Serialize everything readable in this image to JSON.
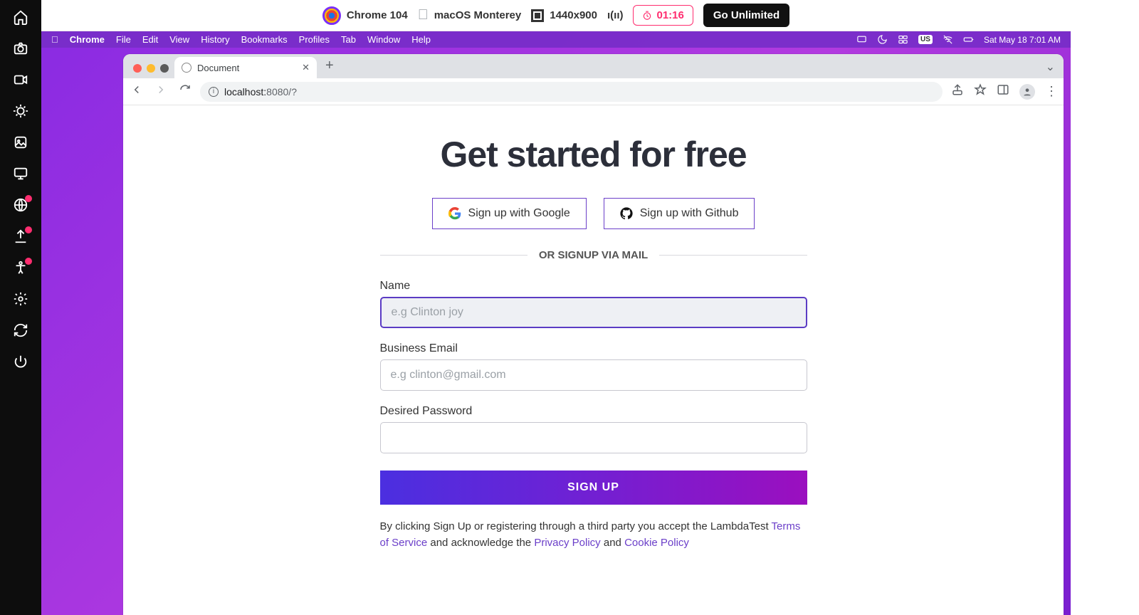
{
  "lt_topbar": {
    "browser": "Chrome 104",
    "os": "macOS Monterey",
    "resolution": "1440x900",
    "timer": "01:16",
    "cta": "Go Unlimited"
  },
  "mac_menu": {
    "app": "Chrome",
    "items": [
      "File",
      "Edit",
      "View",
      "History",
      "Bookmarks",
      "Profiles",
      "Tab",
      "Window",
      "Help"
    ],
    "locale": "US",
    "datetime": "Sat May 18  7:01 AM"
  },
  "chrome": {
    "tab_title": "Document",
    "url_host": "localhost:",
    "url_rest": "8080/?"
  },
  "page": {
    "hero": "Get started for free",
    "google_btn": "Sign up with Google",
    "github_btn": "Sign up with Github",
    "divider": "OR SIGNUP VIA MAIL",
    "name_label": "Name",
    "name_placeholder": "e.g Clinton joy",
    "email_label": "Business Email",
    "email_placeholder": "e.g clinton@gmail.com",
    "pwd_label": "Desired Password",
    "submit": "SIGN UP",
    "legal_pre": "By clicking Sign Up or registering through a third party you accept the LambdaTest ",
    "tos": "Terms of Service",
    "legal_mid": " and acknowledge the ",
    "privacy": "Privacy Policy",
    "legal_and": " and ",
    "cookie": "Cookie Policy"
  }
}
